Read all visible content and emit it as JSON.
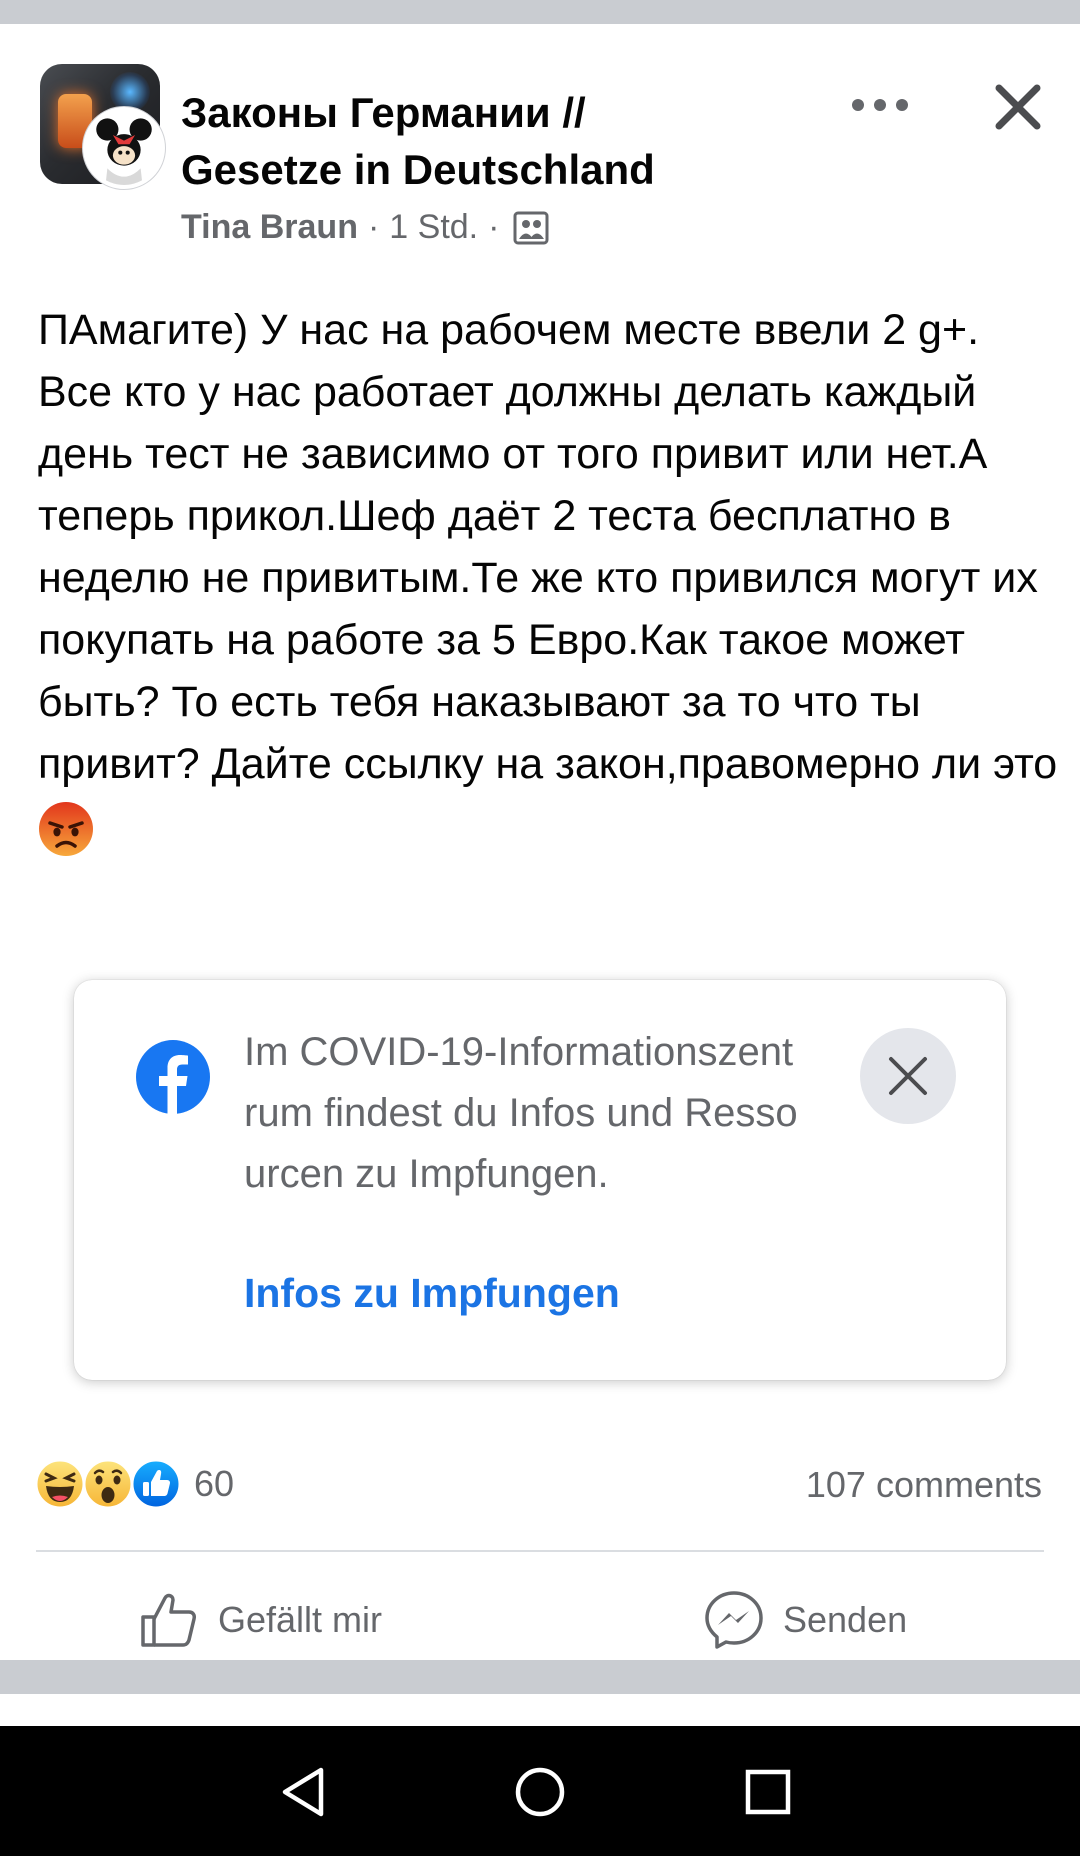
{
  "post": {
    "group_name_line1": "Законы Германии //",
    "group_name_line2": "Gesetze in Deutschland",
    "author": "Tina Braun",
    "time": "1 Std.",
    "separator": "·",
    "audience_icon": "group-icon",
    "more_icon": "more-dots-icon",
    "close_icon": "close-icon",
    "text": "ПАмагите) У нас на рабочем месте ввели 2 g+. Все кто у нас работает должны делать каждый день тест не зависимо от того привит или нет.А теперь прикол.Шеф даёт 2 теста бесплатно в неделю не привитым.Те же кто привился могут их покупать на работе за 5 Евро.Как такое может быть? То есть тебя наказывают за то что ты привит? Дайте ссылку на закон,правомерно ли это",
    "text_emoji": "angry-face-emoji"
  },
  "info_card": {
    "text": "Im COVID-19-Informationszentrum findest du Infos und Ressourcen zu Impfungen.",
    "link": "Infos zu Impfungen",
    "logo": "facebook-logo-icon",
    "close_icon": "close-icon"
  },
  "reactions": {
    "icons": [
      "haha-reaction-icon",
      "wow-reaction-icon",
      "like-reaction-icon"
    ],
    "count": "60",
    "comments": "107 comments"
  },
  "actions": {
    "like_label": "Gefällt mir",
    "send_label": "Senden",
    "like_icon": "thumbs-up-icon",
    "send_icon": "messenger-icon"
  },
  "navbar": {
    "icons": [
      "back-icon",
      "home-icon",
      "recents-icon"
    ]
  },
  "colors": {
    "link_blue": "#1b74e4",
    "secondary_text": "#65676b",
    "separator_gray": "#c9ccd1",
    "reaction_badge_gray": "#e4e6eb"
  }
}
